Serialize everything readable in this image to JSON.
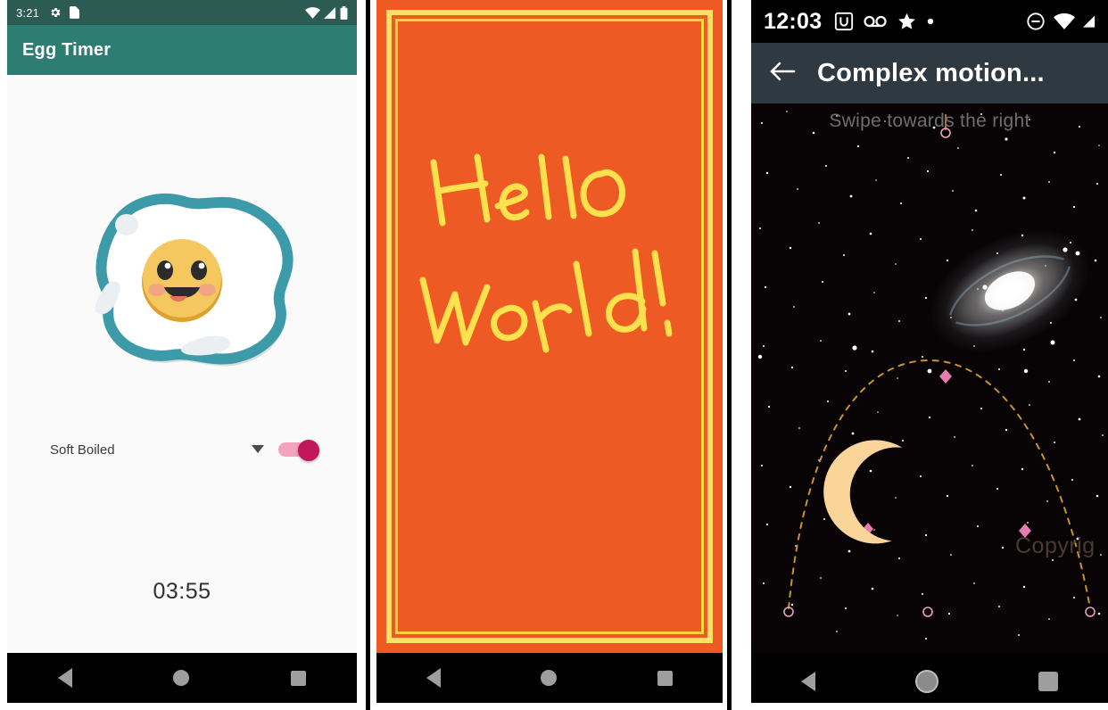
{
  "panels": [
    {
      "id": "egg-timer",
      "statusbar": {
        "time": "3:21",
        "icons": [
          "gear-icon",
          "sim-card-icon",
          "wifi-icon",
          "cell-signal-icon",
          "battery-icon"
        ]
      },
      "appbar": {
        "title": "Egg Timer"
      },
      "illustration": {
        "name": "fried-egg-with-smiling-face"
      },
      "spinner": {
        "value": "Soft Boiled",
        "icon": "chevron-down-icon"
      },
      "toggle": {
        "state": "on",
        "on_color": "#c2185b",
        "track_color": "#f2a3bd"
      },
      "timer": {
        "value": "03:55"
      },
      "navbar": {
        "back": "back-button",
        "home": "home-button",
        "recents": "recents-button"
      }
    },
    {
      "id": "hello-world-canvas",
      "canvas": {
        "background_color": "#ee5a24",
        "border_color": "#ffe066",
        "ink_color": "#ffe14d",
        "handwriting_lines": [
          "Hello",
          "World!"
        ]
      },
      "navbar": {
        "back": "back-button",
        "home": "home-button",
        "recents": "recents-button"
      }
    },
    {
      "id": "complex-motion",
      "statusbar": {
        "time": "12:03",
        "icons": [
          "u-app-icon",
          "voicemail-icon",
          "star-icon",
          "dot-icon",
          "do-not-disturb-icon",
          "wifi-icon",
          "cell-signal-icon"
        ]
      },
      "appbar": {
        "back_icon": "arrow-left-icon",
        "title": "Complex motion..."
      },
      "scene": {
        "hint_text": "Swipe towards the right",
        "watermark_text": "Copyrig",
        "moon": "crescent-moon-icon",
        "path_color": "#c9922e",
        "marker_color": "#e87bb0",
        "background": "starfield-with-spiral-galaxy"
      },
      "navbar": {
        "back": "back-button",
        "home": "home-button",
        "recents": "recents-button"
      }
    }
  ],
  "colors": {
    "egg_appbar": "#2e7d72",
    "egg_statusbar": "#2b5b53",
    "canvas_orange": "#ee5a24",
    "canvas_yellow": "#ffe066",
    "motion_appbar": "#2f3942"
  }
}
